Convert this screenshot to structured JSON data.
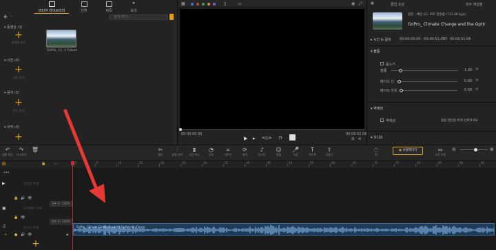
{
  "left_panel": {
    "tabs": [
      {
        "label": "미디어 라이브러리",
        "icon": "media-library-icon",
        "active": true
      },
      {
        "label": "전환",
        "icon": "transition-icon",
        "active": false
      },
      {
        "label": "제목",
        "icon": "title-icon",
        "active": false
      },
      {
        "label": "효과",
        "icon": "effects-icon",
        "active": false
      }
    ],
    "add_label": "+",
    "search_placeholder": "검색 미디...",
    "sections": [
      {
        "title": "동영상",
        "count": "(1)",
        "add_caption": "동영상 추가"
      },
      {
        "title": "사진",
        "count": "(0)",
        "add_caption": "사진 추가"
      },
      {
        "title": "음악",
        "count": "(0)",
        "add_caption": "음악 추가"
      },
      {
        "title": "자막",
        "count": "(0)",
        "add_caption": ""
      }
    ],
    "media_item": {
      "caption": "GoPro_ Cl...n Future"
    }
  },
  "preview": {
    "time_current": "00:00:00.00",
    "time_total": "00:00:51.08",
    "dot_colors": [
      "#3a7bd5",
      "#cc3b3b",
      "#2fa84f",
      "#d58b3a",
      "#8e5bd5",
      "#cccccc"
    ]
  },
  "right_panel": {
    "header_left": "클립 속성",
    "header_right": "모두 재설정",
    "file_info": "원본 : 채널 (2), 비트 전송률 (711.00 kpx)",
    "title": "GoPro_ Climate Change and the Optir",
    "duration_label": "시간 & 길이",
    "duration_range": "00:00:00.00 - 00:00:51.08",
    "duration_total": "00:00:51.08",
    "audio_section": "볼륨",
    "mute_label": "음소거",
    "volume_label": "볼륨",
    "volume_value": "1.00",
    "volume_level": 0.14,
    "fadein_label": "페이드 인",
    "fadein_value": "0.00",
    "fadeout_label": "페이드 아웃",
    "fadeout_value": "0.00",
    "noise_section": "역재생",
    "reverse_label": "역재생",
    "reverse_hint": "클립 원인을 위해 선택하세요",
    "audio_section2": "오디오"
  },
  "toolbar": {
    "undo_label": "실행 취소",
    "redo_label": "다시하기",
    "tools": [
      {
        "label": "잘라",
        "icon": "scissors-icon"
      },
      {
        "label": "분할 분리",
        "icon": "split-icon"
      },
      {
        "label": "시간 모드",
        "icon": "time-mode-icon"
      },
      {
        "label": "속도",
        "icon": "speed-icon"
      },
      {
        "label": "자르기",
        "icon": "crop-icon"
      },
      {
        "label": "회전",
        "icon": "rotate-icon"
      },
      {
        "label": "오디오",
        "icon": "audio-icon"
      },
      {
        "label": "얼굴",
        "icon": "face-icon"
      },
      {
        "label": "녹음",
        "icon": "mic-icon"
      },
      {
        "label": "텍스트",
        "icon": "text-icon"
      },
      {
        "label": "추출기",
        "icon": "extract-icon"
      }
    ],
    "ai_label": "AI",
    "vocal_label": "보컬제거기",
    "fit_label": "크기 조절"
  },
  "timeline": {
    "ruler_labels": [
      "0",
      "5",
      "10",
      "15",
      "20",
      "25",
      "30",
      "35",
      "40",
      "45",
      "50",
      "55",
      "60",
      "65",
      "70",
      "75",
      "80",
      "85",
      "90",
      "95"
    ],
    "tracks": [
      {
        "name": "동영상 트랙",
        "icon": "video-track-icon"
      },
      {
        "name": "오버레이 트랙",
        "icon": "overlay-track-icon"
      },
      {
        "name": "오디오 트랙",
        "icon": "audio-track-icon"
      }
    ],
    "badge_1": "원본 0 / 100%",
    "badge_2": "원본 0 / 100%",
    "clip_label": "GoPro_ Climate Change and the Optimistic Future"
  },
  "annotation": {
    "arrow_color": "#e53935"
  }
}
